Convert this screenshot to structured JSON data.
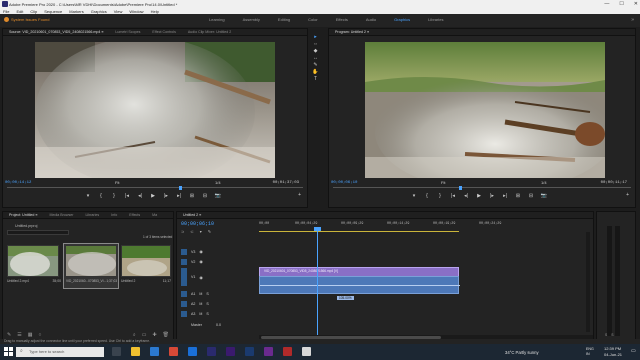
{
  "window": {
    "title": "Adobe Premiere Pro 2020 - C:\\Users\\MR VDHI\\Documents\\Adobe\\Premiere Pro\\14.0\\Untitled *",
    "controls": [
      "—",
      "☐",
      "✕"
    ]
  },
  "menu": [
    "File",
    "Edit",
    "Clip",
    "Sequence",
    "Markers",
    "Graphics",
    "View",
    "Window",
    "Help"
  ],
  "notice": "System Issues Found",
  "workspaces": [
    {
      "label": "Learning",
      "active": false
    },
    {
      "label": "Assembly",
      "active": false
    },
    {
      "label": "Editing",
      "active": false
    },
    {
      "label": "Color",
      "active": false
    },
    {
      "label": "Effects",
      "active": false
    },
    {
      "label": "Audio",
      "active": false
    },
    {
      "label": "Graphics",
      "active": true
    },
    {
      "label": "Libraries",
      "active": false
    }
  ],
  "source": {
    "tabs": [
      "Source: VID_20210601_070853_VID5_2408021566.mp4 ≡",
      "Lumetri Scopes",
      "Effect Controls",
      "Audio Clip Mixer: Untitled 2"
    ],
    "timecode_left": "00;00;14;12",
    "fit": "Fit",
    "scale": "1/4",
    "timecode_right": "00;01;37;03"
  },
  "program": {
    "tab": "Program: Untitled 2 ≡",
    "timecode_left": "00;00;06;10",
    "fit": "Fit",
    "scale": "1/4",
    "timecode_right": "00;00;11;17"
  },
  "transport": [
    "▾",
    "{",
    "}",
    "|◂",
    "◂|",
    "▶",
    "|▸",
    "▸|",
    "⊞",
    "⊟",
    "📷",
    "+"
  ],
  "tools": [
    "▸",
    "⇔",
    "◆",
    "↔",
    "✎",
    "✋",
    "T"
  ],
  "project": {
    "tabs": [
      "Project: Untitled ≡",
      "Media Browser",
      "Libraries",
      "Info",
      "Effects",
      "Ma"
    ],
    "name": "Untitled.prproj",
    "selection": "1 of 3 items selected",
    "items": [
      {
        "name": "Untitled 2.mp4",
        "duration": "35;00"
      },
      {
        "name": "VID_2021060...070853_VI...",
        "duration": "1;37;03"
      },
      {
        "name": "Untitled 2",
        "duration": "11;17"
      }
    ]
  },
  "timeline": {
    "tab": "Untitled 2 ≡",
    "timecode": "00;00;06;10",
    "ruler": [
      "00;00",
      "00;00;04;29",
      "00;00;09;29",
      "00;00;14;29",
      "00;00;19;29",
      "00;00;24;29"
    ],
    "video_tracks": [
      "V3",
      "V2",
      "V1"
    ],
    "audio_tracks": [
      "A1",
      "A2",
      "A3"
    ],
    "master": "Master",
    "master_value": "0.0",
    "clip_name": "VID_20210601_070853_VID5_2408021566.mp4 [V]",
    "speed_label": "105.00%"
  },
  "statusbar": "Drag to manually adjust the connector line until your preferred speed. Use Ctrl to add a keyframe.",
  "taskbar": {
    "search_placeholder": "Type here to search",
    "weather": "34°C  Partly sunny",
    "time": "12:39 PM",
    "date": "04-Jun-21",
    "lang": "ENG\nIN"
  },
  "colors": {
    "accent": "#4aa3ff",
    "video_clip": "#8a6fc6",
    "audio_clip": "#4d78b8",
    "warning": "#e08a2a"
  }
}
